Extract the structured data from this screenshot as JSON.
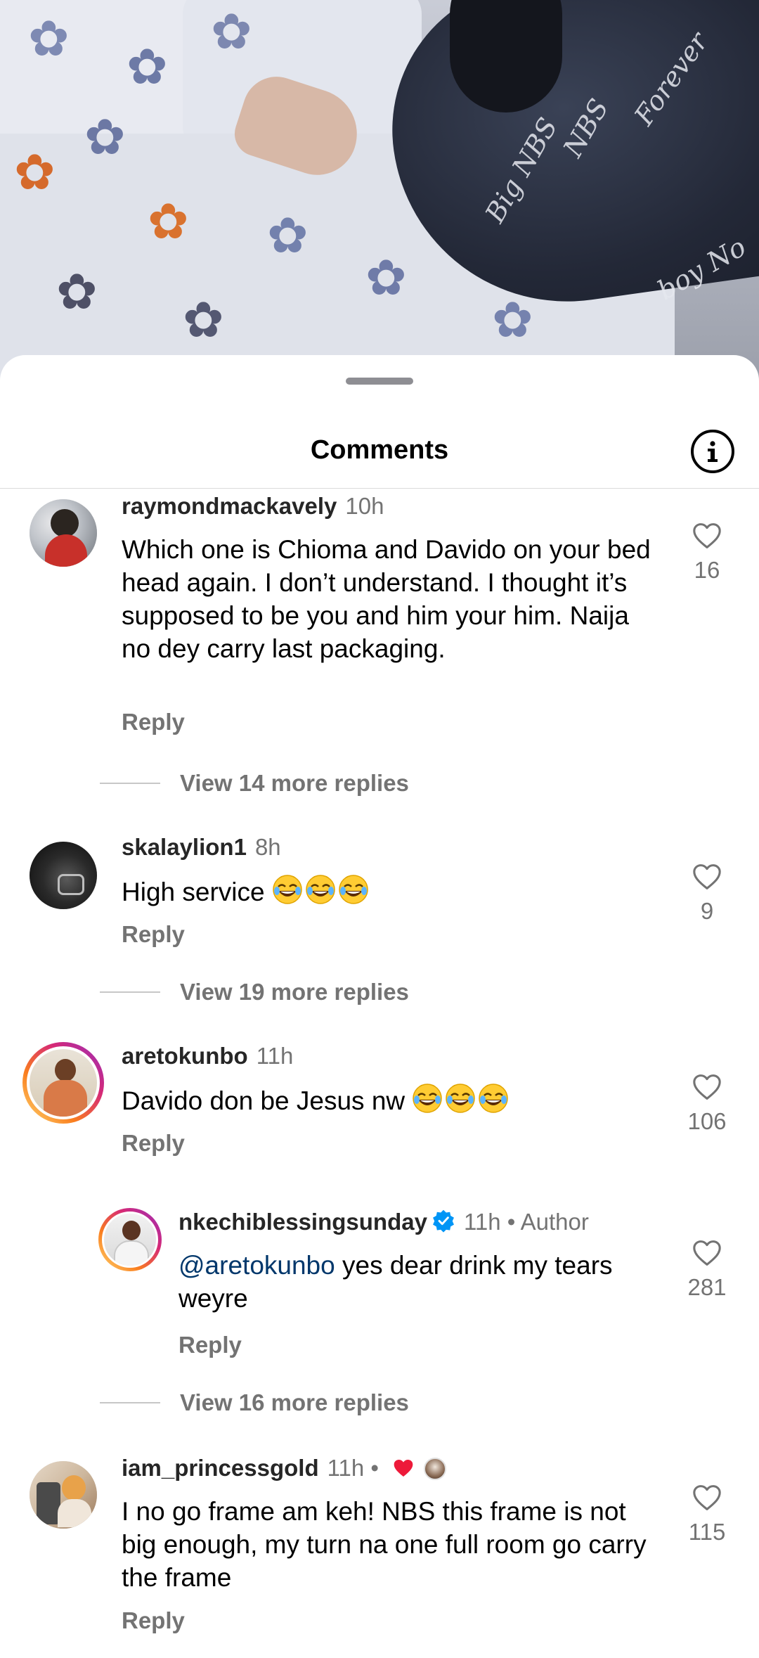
{
  "sheet": {
    "title": "Comments"
  },
  "comments": [
    {
      "username": "raymondmackavely",
      "time": "10h",
      "text": "Which one is Chioma and Davido on your bed head again. I don’t understand. I thought it’s supposed to be you and him your him. Naija no dey carry last packaging.",
      "reply_label": "Reply",
      "likes": "16",
      "view_more": "View 14 more replies"
    },
    {
      "username": "skalaylion1",
      "time": "8h",
      "text": "High service",
      "reply_label": "Reply",
      "likes": "9",
      "view_more": "View 19 more replies"
    },
    {
      "username": "aretokunbo",
      "time": "11h",
      "text": "Davido don be Jesus nw",
      "reply_label": "Reply",
      "likes": "106"
    },
    {
      "username": "nkechiblessingsunday",
      "time": "11h",
      "author_label": "• Author",
      "mention": "@aretokunbo",
      "text": " yes dear drink my tears weyre",
      "reply_label": "Reply",
      "likes": "281",
      "view_more": "View 16 more replies"
    },
    {
      "username": "iam_princessgold",
      "time": "11h •",
      "text": "I no go frame am keh! NBS this frame is not big enough, my turn na one full room go carry the frame",
      "reply_label": "Reply",
      "likes": "115"
    }
  ],
  "colors": {
    "secondary_text": "#737373",
    "mention": "#00376b",
    "verified": "#0095f6",
    "heart_red": "#ed1a3a"
  },
  "icons": [
    "info-icon",
    "heart-outline-icon",
    "verified-badge-icon",
    "laughing-emoji-icon",
    "red-heart-icon"
  ]
}
